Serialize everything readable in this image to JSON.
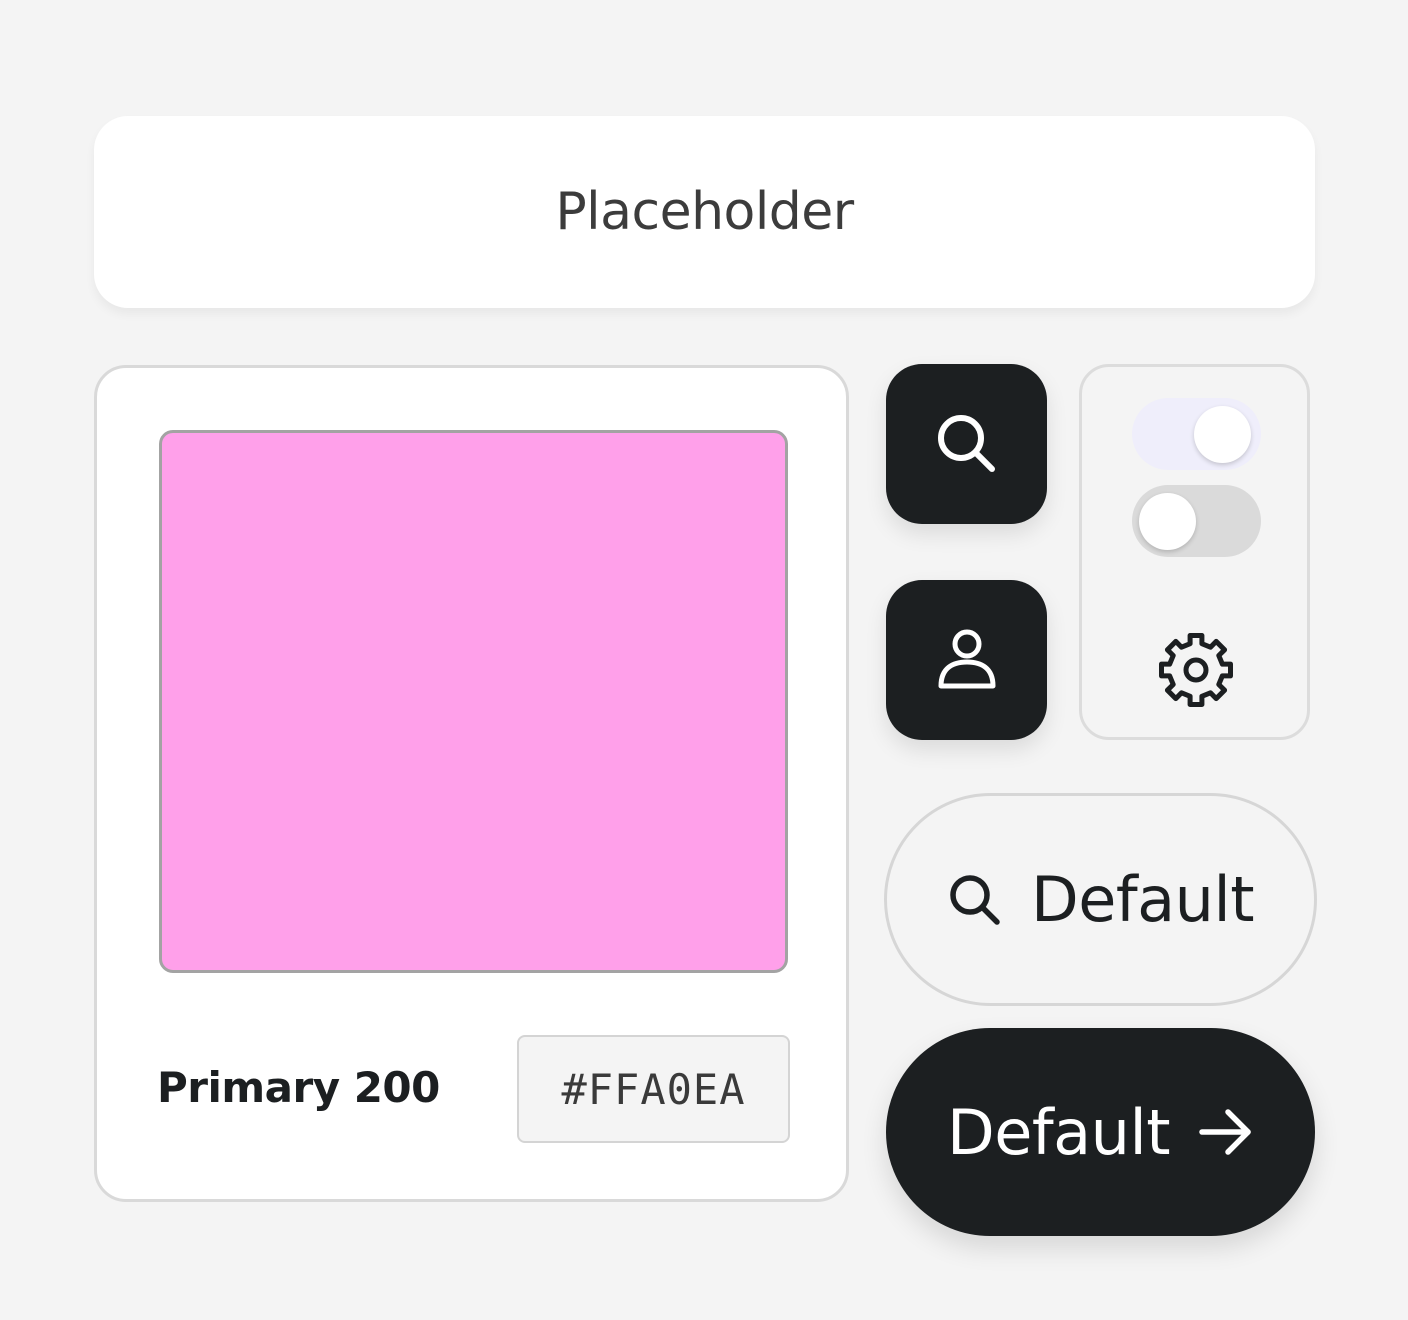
{
  "search": {
    "placeholder": "Placeholder"
  },
  "color_card": {
    "name": "Primary 200",
    "hex": "#FFA0EA",
    "swatch_color": "#FFA0EA"
  },
  "icons": {
    "search_button": "search-icon",
    "user_button": "user-icon",
    "settings": "gear-icon",
    "pill_button": "search-icon",
    "cta_button": "arrow-right-icon"
  },
  "toggles": [
    {
      "state": "on"
    },
    {
      "state": "off"
    }
  ],
  "buttons": {
    "pill_label": "Default",
    "cta_label": "Default"
  },
  "colors": {
    "background": "#F4F4F4",
    "dark": "#1C1F21",
    "surface": "#FFFFFF",
    "toggle_on_track": "#EFEEFB",
    "toggle_off_track": "#DADADA"
  }
}
